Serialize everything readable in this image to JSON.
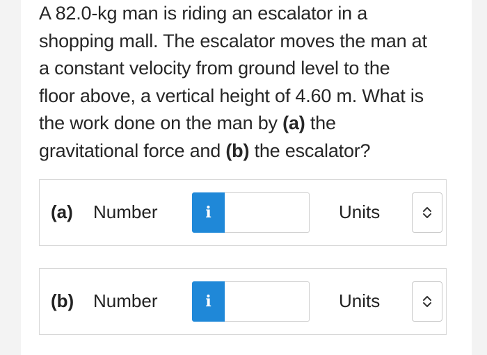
{
  "question": {
    "line1": "A 82.0-kg man is riding an escalator in a",
    "line2": "shopping mall. The escalator moves the man at",
    "line3": "a constant velocity from ground level to the",
    "line4": "floor above, a vertical height of 4.60 m. What is",
    "line5_pre": "the work done on the man by ",
    "line5_bold": "(a)",
    "line5_post": " the",
    "line6_pre": "gravitational force and ",
    "line6_bold": "(b)",
    "line6_post": " the escalator?"
  },
  "answers": [
    {
      "part_label": "(a)",
      "number_label": "Number",
      "info_icon_text": "i",
      "number_value": "",
      "units_label": "Units",
      "units_selected": "",
      "icon": "chevron-up-down-icon"
    },
    {
      "part_label": "(b)",
      "number_label": "Number",
      "info_icon_text": "i",
      "number_value": "",
      "units_label": "Units",
      "units_selected": "",
      "icon": "chevron-up-down-icon"
    }
  ],
  "colors": {
    "info_button": "#1f88d8",
    "border": "#d8d8d8",
    "text": "#222222"
  }
}
